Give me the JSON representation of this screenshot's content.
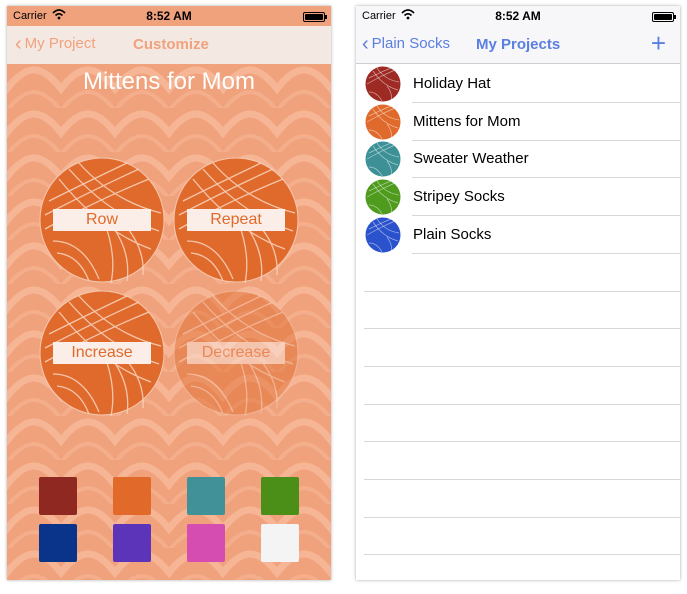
{
  "left_screen": {
    "status": {
      "carrier": "Carrier",
      "time": "8:52 AM"
    },
    "nav": {
      "back_label": "My Project",
      "title": "Customize"
    },
    "project_title": "Mittens for Mom",
    "buttons": [
      {
        "label": "Row",
        "enabled": true
      },
      {
        "label": "Repeat",
        "enabled": true
      },
      {
        "label": "Increase",
        "enabled": true
      },
      {
        "label": "Decrease",
        "enabled": false
      }
    ],
    "swatches": [
      "#8e2820",
      "#e16a2b",
      "#419298",
      "#4c8f18",
      "#0a338a",
      "#5b34ba",
      "#d64db2",
      "#f4f4f4"
    ],
    "theme": {
      "background": "#f0a27d",
      "accent": "#e06a2b",
      "nav_tint": "#f0a27d",
      "nav_bar": "#f4e8e3"
    }
  },
  "right_screen": {
    "status": {
      "carrier": "Carrier",
      "time": "8:52 AM"
    },
    "nav": {
      "back_label": "Plain Socks",
      "title": "My Projects",
      "add_icon": "plus-icon"
    },
    "projects": [
      {
        "name": "Holiday Hat",
        "color": "#9e2a24"
      },
      {
        "name": "Mittens for Mom",
        "color": "#e06a2b"
      },
      {
        "name": "Sweater Weather",
        "color": "#3d9196"
      },
      {
        "name": "Stripey Socks",
        "color": "#4e9b1e"
      },
      {
        "name": "Plain Socks",
        "color": "#2a52cc"
      }
    ],
    "theme": {
      "accent": "#5b7fe0"
    }
  }
}
